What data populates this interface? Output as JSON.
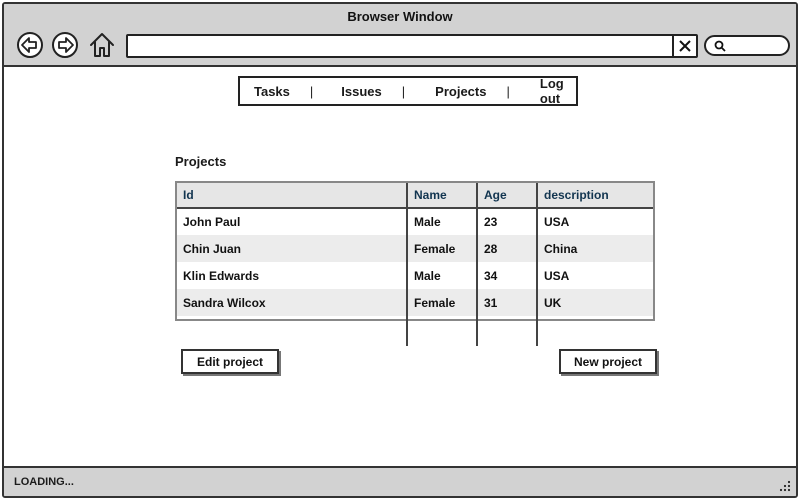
{
  "window": {
    "title": "Browser Window"
  },
  "browser": {
    "back_icon": "back-arrow-icon",
    "forward_icon": "forward-arrow-icon",
    "home_icon": "home-icon",
    "url_value": "",
    "clear_icon": "close-icon",
    "search_icon": "search-icon",
    "search_value": ""
  },
  "menu": {
    "items": [
      "Tasks",
      "Issues",
      "Projects",
      "Log out"
    ],
    "separator": "|"
  },
  "projects": {
    "title": "Projects",
    "columns": [
      "Id",
      "Name",
      "Age",
      "description"
    ],
    "rows": [
      [
        "John Paul",
        "Male",
        "23",
        "USA"
      ],
      [
        "Chin Juan",
        "Female",
        "28",
        "China"
      ],
      [
        "Klin Edwards",
        "Male",
        "34",
        "USA"
      ],
      [
        "Sandra Wilcox",
        "Female",
        "31",
        "UK"
      ]
    ]
  },
  "actions": {
    "edit_label": "Edit project",
    "new_label": "New project"
  },
  "status": {
    "text": "LOADING..."
  },
  "colors": {
    "chrome": "#d2d2d2",
    "header_text": "#123550",
    "alt_row": "#ececec"
  }
}
